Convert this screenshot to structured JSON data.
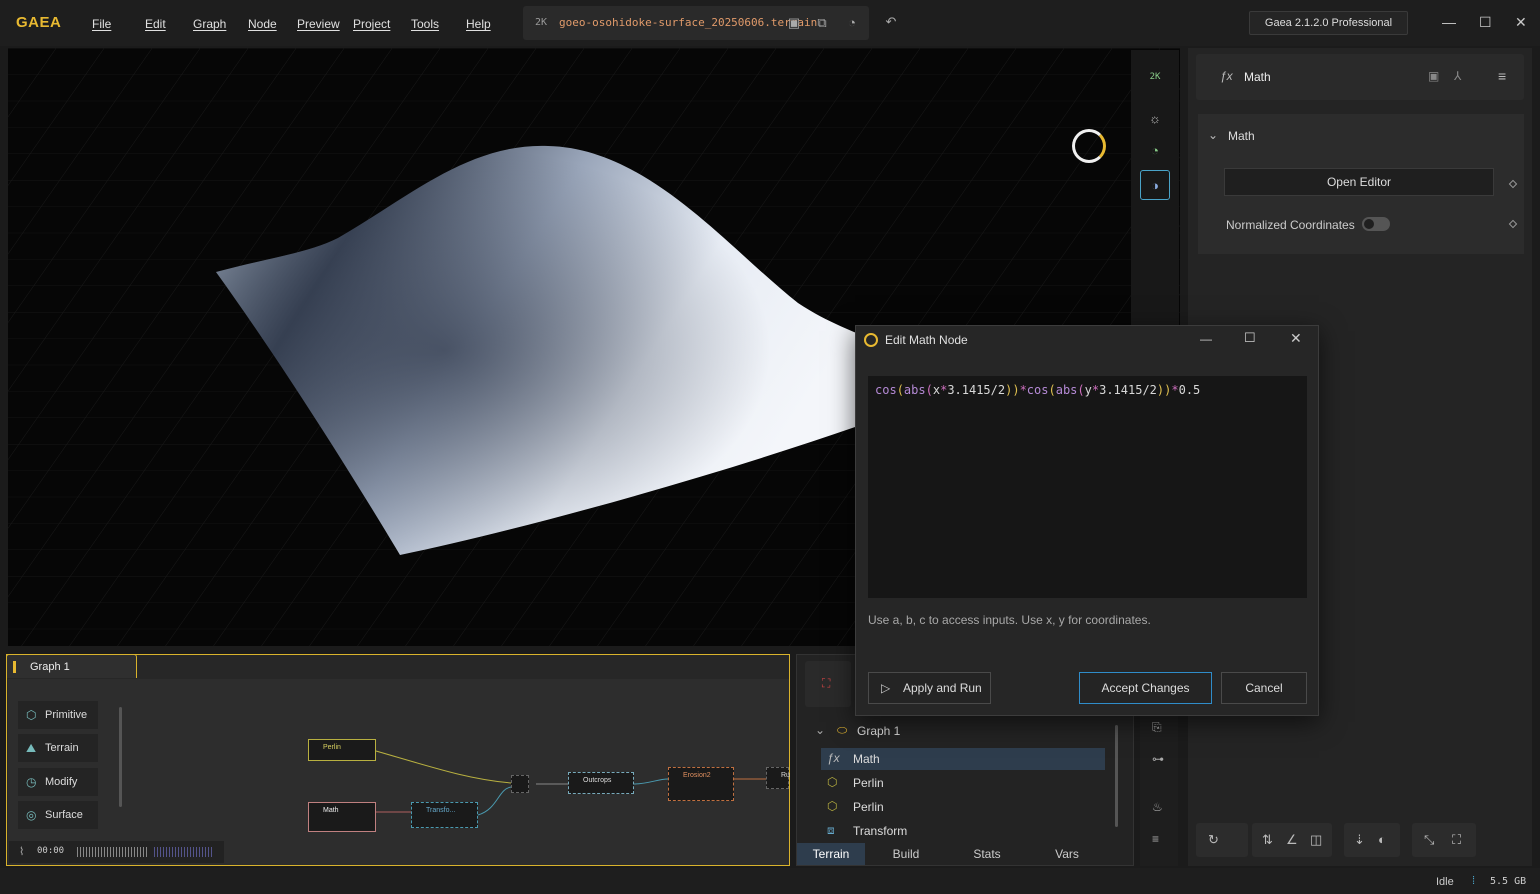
{
  "app": {
    "logo": "GAEA",
    "menu": [
      "File",
      "Edit",
      "Graph",
      "Node",
      "Preview",
      "Project",
      "Tools",
      "Help"
    ],
    "resolution_badge": "2K",
    "file_name": "goeo-osohidoke-surface_20250606.terrain",
    "version": "Gaea 2.1.2.0 Professional"
  },
  "viewport": {
    "toolbar_resolution": "2K"
  },
  "properties": {
    "node_title": "Math",
    "section_title": "Math",
    "open_editor_label": "Open Editor",
    "normalized_coords_label": "Normalized Coordinates",
    "normalized_coords_on": false
  },
  "graph": {
    "tab_label": "Graph 1",
    "library": [
      "Primitive",
      "Terrain",
      "Modify",
      "Surface"
    ],
    "nodes": {
      "perlin": "Perlin",
      "math": "Math",
      "transform": "Transfo...",
      "outcrops": "Outcrops",
      "erosion": "Erosion2",
      "ru": "Ru"
    },
    "time": "00:00"
  },
  "tree": {
    "root": "Graph 1",
    "items": [
      {
        "label": "Math",
        "icon": "fx-icon",
        "selected": true
      },
      {
        "label": "Perlin",
        "icon": "hexagon-icon",
        "selected": false
      },
      {
        "label": "Perlin",
        "icon": "hexagon-icon",
        "selected": false
      },
      {
        "label": "Transform",
        "icon": "transform-icon",
        "selected": false
      }
    ],
    "tabs": [
      "Terrain",
      "Build",
      "Stats",
      "Vars"
    ],
    "active_tab": "Terrain"
  },
  "dialog": {
    "title": "Edit Math Node",
    "code_parts": [
      {
        "t": "cos",
        "c": "#b58ad6"
      },
      {
        "t": "(",
        "c": "#e0c050"
      },
      {
        "t": "abs",
        "c": "#b58ad6"
      },
      {
        "t": "(",
        "c": "#d070c0"
      },
      {
        "t": "x",
        "c": "#d8d8d8"
      },
      {
        "t": "*",
        "c": "#d070c0"
      },
      {
        "t": "3.1415/2",
        "c": "#d8d8d8"
      },
      {
        "t": "))",
        "c": "#e0c050"
      },
      {
        "t": "*",
        "c": "#d070c0"
      },
      {
        "t": "cos",
        "c": "#b58ad6"
      },
      {
        "t": "(",
        "c": "#e0c050"
      },
      {
        "t": "abs",
        "c": "#b58ad6"
      },
      {
        "t": "(",
        "c": "#d070c0"
      },
      {
        "t": "y",
        "c": "#d8d8d8"
      },
      {
        "t": "*",
        "c": "#d070c0"
      },
      {
        "t": "3.1415/2",
        "c": "#d8d8d8"
      },
      {
        "t": "))",
        "c": "#e0c050"
      },
      {
        "t": "*",
        "c": "#d070c0"
      },
      {
        "t": "0.5",
        "c": "#d8d8d8"
      }
    ],
    "hint": "Use a, b, c to access inputs. Use x, y for coordinates.",
    "apply_label": "Apply and Run",
    "accept_label": "Accept Changes",
    "cancel_label": "Cancel"
  },
  "status": {
    "state": "Idle",
    "memory": "5.5 GB"
  },
  "colors": {
    "accent": "#e8b931",
    "selection": "#2e3d4d",
    "focus": "#2f8cc9"
  }
}
